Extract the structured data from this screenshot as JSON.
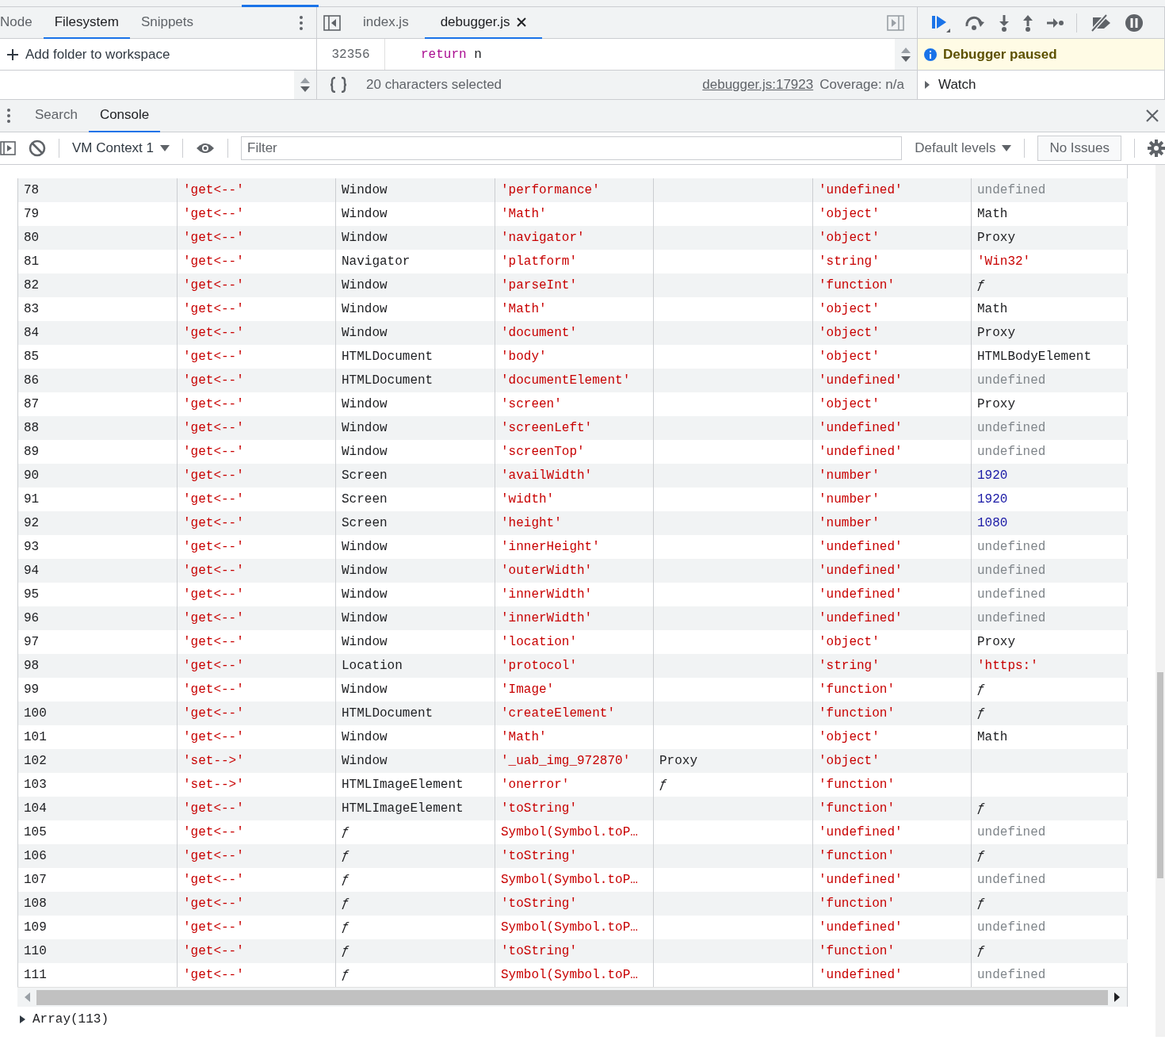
{
  "navigator": {
    "tabs": [
      {
        "label": "Node",
        "selected": false
      },
      {
        "label": "Filesystem",
        "selected": true
      },
      {
        "label": "Snippets",
        "selected": false
      }
    ],
    "add_folder": "Add folder to workspace"
  },
  "editor": {
    "tabs": [
      {
        "label": "index.js",
        "selected": false,
        "closable": false
      },
      {
        "label": "debugger.js",
        "selected": true,
        "closable": true
      }
    ],
    "code_lines": [
      {
        "number": "32356",
        "keyword": "return",
        "rest": "n"
      }
    ],
    "status": {
      "selection": "20 characters selected",
      "location_link": "debugger.js:17923",
      "coverage": "Coverage: n/a"
    }
  },
  "debugger": {
    "banner": "Debugger paused",
    "sections": [
      {
        "label": "Watch",
        "expanded": false
      }
    ]
  },
  "drawer": {
    "tabs": [
      {
        "label": "Search",
        "selected": false
      },
      {
        "label": "Console",
        "selected": true
      }
    ]
  },
  "console": {
    "context": "VM Context 1",
    "filter": {
      "placeholder": "Filter"
    },
    "levels": "Default levels",
    "issues": "No Issues",
    "rows": [
      {
        "cells": [
          {
            "text": "78",
            "kind": "plain"
          },
          {
            "text": "'get<--'",
            "kind": "string"
          },
          {
            "text": "Window",
            "kind": "plain"
          },
          {
            "text": "'performance'",
            "kind": "string"
          },
          {
            "kind": "blank"
          },
          {
            "text": "'undefined'",
            "kind": "string"
          },
          {
            "text": "undefined",
            "kind": "undefined"
          }
        ]
      },
      {
        "cells": [
          {
            "text": "79",
            "kind": "plain"
          },
          {
            "text": "'get<--'",
            "kind": "string"
          },
          {
            "text": "Window",
            "kind": "plain"
          },
          {
            "text": "'Math'",
            "kind": "string"
          },
          {
            "kind": "blank"
          },
          {
            "text": "'object'",
            "kind": "string"
          },
          {
            "text": "Math",
            "kind": "plain"
          }
        ]
      },
      {
        "cells": [
          {
            "text": "80",
            "kind": "plain"
          },
          {
            "text": "'get<--'",
            "kind": "string"
          },
          {
            "text": "Window",
            "kind": "plain"
          },
          {
            "text": "'navigator'",
            "kind": "string"
          },
          {
            "kind": "blank"
          },
          {
            "text": "'object'",
            "kind": "string"
          },
          {
            "text": "Proxy",
            "kind": "plain"
          }
        ]
      },
      {
        "cells": [
          {
            "text": "81",
            "kind": "plain"
          },
          {
            "text": "'get<--'",
            "kind": "string"
          },
          {
            "text": "Navigator",
            "kind": "plain"
          },
          {
            "text": "'platform'",
            "kind": "string"
          },
          {
            "kind": "blank"
          },
          {
            "text": "'string'",
            "kind": "string"
          },
          {
            "text": "'Win32'",
            "kind": "string"
          }
        ]
      },
      {
        "cells": [
          {
            "text": "82",
            "kind": "plain"
          },
          {
            "text": "'get<--'",
            "kind": "string"
          },
          {
            "text": "Window",
            "kind": "plain"
          },
          {
            "text": "'parseInt'",
            "kind": "string"
          },
          {
            "kind": "blank"
          },
          {
            "text": "'function'",
            "kind": "string"
          },
          {
            "text": "ƒ",
            "kind": "func"
          }
        ]
      },
      {
        "cells": [
          {
            "text": "83",
            "kind": "plain"
          },
          {
            "text": "'get<--'",
            "kind": "string"
          },
          {
            "text": "Window",
            "kind": "plain"
          },
          {
            "text": "'Math'",
            "kind": "string"
          },
          {
            "kind": "blank"
          },
          {
            "text": "'object'",
            "kind": "string"
          },
          {
            "text": "Math",
            "kind": "plain"
          }
        ]
      },
      {
        "cells": [
          {
            "text": "84",
            "kind": "plain"
          },
          {
            "text": "'get<--'",
            "kind": "string"
          },
          {
            "text": "Window",
            "kind": "plain"
          },
          {
            "text": "'document'",
            "kind": "string"
          },
          {
            "kind": "blank"
          },
          {
            "text": "'object'",
            "kind": "string"
          },
          {
            "text": "Proxy",
            "kind": "plain"
          }
        ]
      },
      {
        "cells": [
          {
            "text": "85",
            "kind": "plain"
          },
          {
            "text": "'get<--'",
            "kind": "string"
          },
          {
            "text": "HTMLDocument",
            "kind": "plain"
          },
          {
            "text": "'body'",
            "kind": "string"
          },
          {
            "kind": "blank"
          },
          {
            "text": "'object'",
            "kind": "string"
          },
          {
            "text": "HTMLBodyElement",
            "kind": "plain"
          }
        ]
      },
      {
        "cells": [
          {
            "text": "86",
            "kind": "plain"
          },
          {
            "text": "'get<--'",
            "kind": "string"
          },
          {
            "text": "HTMLDocument",
            "kind": "plain"
          },
          {
            "text": "'documentElement'",
            "kind": "string"
          },
          {
            "kind": "blank"
          },
          {
            "text": "'undefined'",
            "kind": "string"
          },
          {
            "text": "undefined",
            "kind": "undefined"
          }
        ]
      },
      {
        "cells": [
          {
            "text": "87",
            "kind": "plain"
          },
          {
            "text": "'get<--'",
            "kind": "string"
          },
          {
            "text": "Window",
            "kind": "plain"
          },
          {
            "text": "'screen'",
            "kind": "string"
          },
          {
            "kind": "blank"
          },
          {
            "text": "'object'",
            "kind": "string"
          },
          {
            "text": "Proxy",
            "kind": "plain"
          }
        ]
      },
      {
        "cells": [
          {
            "text": "88",
            "kind": "plain"
          },
          {
            "text": "'get<--'",
            "kind": "string"
          },
          {
            "text": "Window",
            "kind": "plain"
          },
          {
            "text": "'screenLeft'",
            "kind": "string"
          },
          {
            "kind": "blank"
          },
          {
            "text": "'undefined'",
            "kind": "string"
          },
          {
            "text": "undefined",
            "kind": "undefined"
          }
        ]
      },
      {
        "cells": [
          {
            "text": "89",
            "kind": "plain"
          },
          {
            "text": "'get<--'",
            "kind": "string"
          },
          {
            "text": "Window",
            "kind": "plain"
          },
          {
            "text": "'screenTop'",
            "kind": "string"
          },
          {
            "kind": "blank"
          },
          {
            "text": "'undefined'",
            "kind": "string"
          },
          {
            "text": "undefined",
            "kind": "undefined"
          }
        ]
      },
      {
        "cells": [
          {
            "text": "90",
            "kind": "plain"
          },
          {
            "text": "'get<--'",
            "kind": "string"
          },
          {
            "text": "Screen",
            "kind": "plain"
          },
          {
            "text": "'availWidth'",
            "kind": "string"
          },
          {
            "kind": "blank"
          },
          {
            "text": "'number'",
            "kind": "string"
          },
          {
            "text": "1920",
            "kind": "number"
          }
        ]
      },
      {
        "cells": [
          {
            "text": "91",
            "kind": "plain"
          },
          {
            "text": "'get<--'",
            "kind": "string"
          },
          {
            "text": "Screen",
            "kind": "plain"
          },
          {
            "text": "'width'",
            "kind": "string"
          },
          {
            "kind": "blank"
          },
          {
            "text": "'number'",
            "kind": "string"
          },
          {
            "text": "1920",
            "kind": "number"
          }
        ]
      },
      {
        "cells": [
          {
            "text": "92",
            "kind": "plain"
          },
          {
            "text": "'get<--'",
            "kind": "string"
          },
          {
            "text": "Screen",
            "kind": "plain"
          },
          {
            "text": "'height'",
            "kind": "string"
          },
          {
            "kind": "blank"
          },
          {
            "text": "'number'",
            "kind": "string"
          },
          {
            "text": "1080",
            "kind": "number"
          }
        ]
      },
      {
        "cells": [
          {
            "text": "93",
            "kind": "plain"
          },
          {
            "text": "'get<--'",
            "kind": "string"
          },
          {
            "text": "Window",
            "kind": "plain"
          },
          {
            "text": "'innerHeight'",
            "kind": "string"
          },
          {
            "kind": "blank"
          },
          {
            "text": "'undefined'",
            "kind": "string"
          },
          {
            "text": "undefined",
            "kind": "undefined"
          }
        ]
      },
      {
        "cells": [
          {
            "text": "94",
            "kind": "plain"
          },
          {
            "text": "'get<--'",
            "kind": "string"
          },
          {
            "text": "Window",
            "kind": "plain"
          },
          {
            "text": "'outerWidth'",
            "kind": "string"
          },
          {
            "kind": "blank"
          },
          {
            "text": "'undefined'",
            "kind": "string"
          },
          {
            "text": "undefined",
            "kind": "undefined"
          }
        ]
      },
      {
        "cells": [
          {
            "text": "95",
            "kind": "plain"
          },
          {
            "text": "'get<--'",
            "kind": "string"
          },
          {
            "text": "Window",
            "kind": "plain"
          },
          {
            "text": "'innerWidth'",
            "kind": "string"
          },
          {
            "kind": "blank"
          },
          {
            "text": "'undefined'",
            "kind": "string"
          },
          {
            "text": "undefined",
            "kind": "undefined"
          }
        ]
      },
      {
        "cells": [
          {
            "text": "96",
            "kind": "plain"
          },
          {
            "text": "'get<--'",
            "kind": "string"
          },
          {
            "text": "Window",
            "kind": "plain"
          },
          {
            "text": "'innerWidth'",
            "kind": "string"
          },
          {
            "kind": "blank"
          },
          {
            "text": "'undefined'",
            "kind": "string"
          },
          {
            "text": "undefined",
            "kind": "undefined"
          }
        ]
      },
      {
        "cells": [
          {
            "text": "97",
            "kind": "plain"
          },
          {
            "text": "'get<--'",
            "kind": "string"
          },
          {
            "text": "Window",
            "kind": "plain"
          },
          {
            "text": "'location'",
            "kind": "string"
          },
          {
            "kind": "blank"
          },
          {
            "text": "'object'",
            "kind": "string"
          },
          {
            "text": "Proxy",
            "kind": "plain"
          }
        ]
      },
      {
        "cells": [
          {
            "text": "98",
            "kind": "plain"
          },
          {
            "text": "'get<--'",
            "kind": "string"
          },
          {
            "text": "Location",
            "kind": "plain"
          },
          {
            "text": "'protocol'",
            "kind": "string"
          },
          {
            "kind": "blank"
          },
          {
            "text": "'string'",
            "kind": "string"
          },
          {
            "text": "'https:'",
            "kind": "string"
          }
        ]
      },
      {
        "cells": [
          {
            "text": "99",
            "kind": "plain"
          },
          {
            "text": "'get<--'",
            "kind": "string"
          },
          {
            "text": "Window",
            "kind": "plain"
          },
          {
            "text": "'Image'",
            "kind": "string"
          },
          {
            "kind": "blank"
          },
          {
            "text": "'function'",
            "kind": "string"
          },
          {
            "text": "ƒ",
            "kind": "func"
          }
        ]
      },
      {
        "cells": [
          {
            "text": "100",
            "kind": "plain"
          },
          {
            "text": "'get<--'",
            "kind": "string"
          },
          {
            "text": "HTMLDocument",
            "kind": "plain"
          },
          {
            "text": "'createElement'",
            "kind": "string"
          },
          {
            "kind": "blank"
          },
          {
            "text": "'function'",
            "kind": "string"
          },
          {
            "text": "ƒ",
            "kind": "func"
          }
        ]
      },
      {
        "cells": [
          {
            "text": "101",
            "kind": "plain"
          },
          {
            "text": "'get<--'",
            "kind": "string"
          },
          {
            "text": "Window",
            "kind": "plain"
          },
          {
            "text": "'Math'",
            "kind": "string"
          },
          {
            "kind": "blank"
          },
          {
            "text": "'object'",
            "kind": "string"
          },
          {
            "text": "Math",
            "kind": "plain"
          }
        ]
      },
      {
        "cells": [
          {
            "text": "102",
            "kind": "plain"
          },
          {
            "text": "'set-->'",
            "kind": "string"
          },
          {
            "text": "Window",
            "kind": "plain"
          },
          {
            "text": "'_uab_img_972870'",
            "kind": "string"
          },
          {
            "text": "Proxy",
            "kind": "plain"
          },
          {
            "text": "'object'",
            "kind": "string"
          },
          {
            "kind": "blank"
          }
        ]
      },
      {
        "cells": [
          {
            "text": "103",
            "kind": "plain"
          },
          {
            "text": "'set-->'",
            "kind": "string"
          },
          {
            "text": "HTMLImageElement",
            "kind": "plain"
          },
          {
            "text": "'onerror'",
            "kind": "string"
          },
          {
            "text": "ƒ",
            "kind": "func"
          },
          {
            "text": "'function'",
            "kind": "string"
          },
          {
            "kind": "blank"
          }
        ]
      },
      {
        "cells": [
          {
            "text": "104",
            "kind": "plain"
          },
          {
            "text": "'get<--'",
            "kind": "string"
          },
          {
            "text": "HTMLImageElement",
            "kind": "plain"
          },
          {
            "text": "'toString'",
            "kind": "string"
          },
          {
            "kind": "blank"
          },
          {
            "text": "'function'",
            "kind": "string"
          },
          {
            "text": "ƒ",
            "kind": "func"
          }
        ]
      },
      {
        "cells": [
          {
            "text": "105",
            "kind": "plain"
          },
          {
            "text": "'get<--'",
            "kind": "string"
          },
          {
            "text": "ƒ",
            "kind": "func"
          },
          {
            "text": "Symbol(Symbol.toP…",
            "kind": "string"
          },
          {
            "kind": "blank"
          },
          {
            "text": "'undefined'",
            "kind": "string"
          },
          {
            "text": "undefined",
            "kind": "undefined"
          }
        ]
      },
      {
        "cells": [
          {
            "text": "106",
            "kind": "plain"
          },
          {
            "text": "'get<--'",
            "kind": "string"
          },
          {
            "text": "ƒ",
            "kind": "func"
          },
          {
            "text": "'toString'",
            "kind": "string"
          },
          {
            "kind": "blank"
          },
          {
            "text": "'function'",
            "kind": "string"
          },
          {
            "text": "ƒ",
            "kind": "func"
          }
        ]
      },
      {
        "cells": [
          {
            "text": "107",
            "kind": "plain"
          },
          {
            "text": "'get<--'",
            "kind": "string"
          },
          {
            "text": "ƒ",
            "kind": "func"
          },
          {
            "text": "Symbol(Symbol.toP…",
            "kind": "string"
          },
          {
            "kind": "blank"
          },
          {
            "text": "'undefined'",
            "kind": "string"
          },
          {
            "text": "undefined",
            "kind": "undefined"
          }
        ]
      },
      {
        "cells": [
          {
            "text": "108",
            "kind": "plain"
          },
          {
            "text": "'get<--'",
            "kind": "string"
          },
          {
            "text": "ƒ",
            "kind": "func"
          },
          {
            "text": "'toString'",
            "kind": "string"
          },
          {
            "kind": "blank"
          },
          {
            "text": "'function'",
            "kind": "string"
          },
          {
            "text": "ƒ",
            "kind": "func"
          }
        ]
      },
      {
        "cells": [
          {
            "text": "109",
            "kind": "plain"
          },
          {
            "text": "'get<--'",
            "kind": "string"
          },
          {
            "text": "ƒ",
            "kind": "func"
          },
          {
            "text": "Symbol(Symbol.toP…",
            "kind": "string"
          },
          {
            "kind": "blank"
          },
          {
            "text": "'undefined'",
            "kind": "string"
          },
          {
            "text": "undefined",
            "kind": "undefined"
          }
        ]
      },
      {
        "cells": [
          {
            "text": "110",
            "kind": "plain"
          },
          {
            "text": "'get<--'",
            "kind": "string"
          },
          {
            "text": "ƒ",
            "kind": "func"
          },
          {
            "text": "'toString'",
            "kind": "string"
          },
          {
            "kind": "blank"
          },
          {
            "text": "'function'",
            "kind": "string"
          },
          {
            "text": "ƒ",
            "kind": "func"
          }
        ]
      },
      {
        "cells": [
          {
            "text": "111",
            "kind": "plain"
          },
          {
            "text": "'get<--'",
            "kind": "string"
          },
          {
            "text": "ƒ",
            "kind": "func"
          },
          {
            "text": "Symbol(Symbol.toP…",
            "kind": "string"
          },
          {
            "kind": "blank"
          },
          {
            "text": "'undefined'",
            "kind": "string"
          },
          {
            "text": "undefined",
            "kind": "undefined"
          }
        ]
      }
    ],
    "result": {
      "label": "Array(113)",
      "expanded": false
    }
  }
}
